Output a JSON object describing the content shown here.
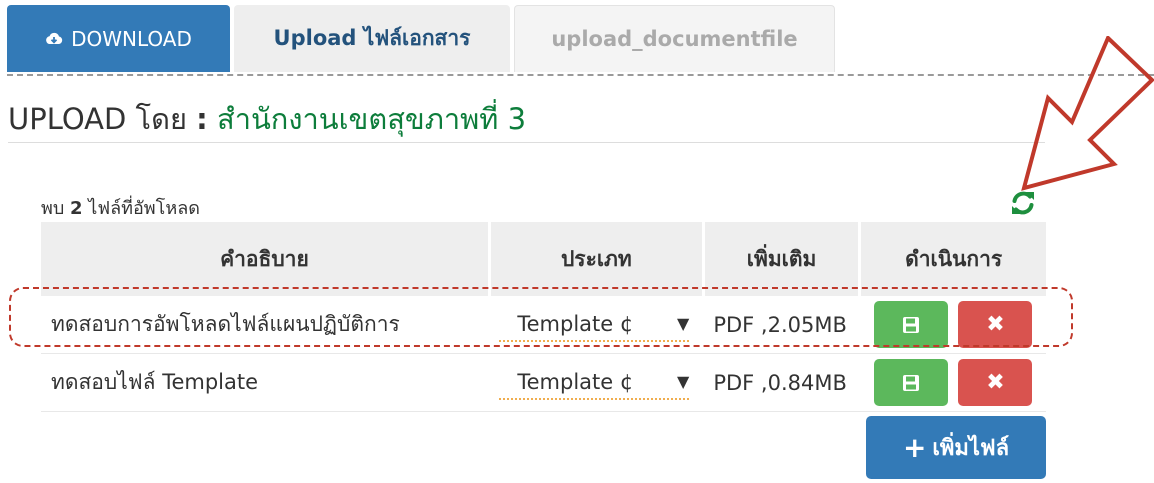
{
  "tabs": [
    {
      "label": "DOWNLOAD",
      "icon": "cloud-download-icon"
    },
    {
      "label": "Upload ไฟล์เอกสาร"
    },
    {
      "label": "upload_documentfile"
    }
  ],
  "heading": {
    "prefix": "UPLOAD โดย",
    "colon": ":",
    "organization": "สำนักงานเขตสุขภาพที่ 3"
  },
  "file_count": {
    "prefix": "พบ",
    "count": "2",
    "suffix": "ไฟล์ที่อัพโหลด"
  },
  "table": {
    "headers": [
      "คำอธิบาย",
      "ประเภท",
      "เพิ่มเติม",
      "ดำเนินการ"
    ],
    "rows": [
      {
        "description": "ทดสอบการอัพโหลดไฟล์แผนปฏิบัติการ",
        "type": "Template ¢",
        "extra": "PDF ,2.05MB"
      },
      {
        "description": "ทดสอบไฟล์ Template",
        "type": "Template ¢",
        "extra": "PDF ,0.84MB"
      }
    ]
  },
  "actions": {
    "delete_symbol": "✖",
    "add_file_label": "เพิ่มไฟล์",
    "add_symbol": "+"
  },
  "colors": {
    "primary": "#337ab7",
    "success": "#5cb85c",
    "danger": "#d9534f",
    "org_text": "#0d7d3b",
    "annotation": "#c0392b"
  }
}
